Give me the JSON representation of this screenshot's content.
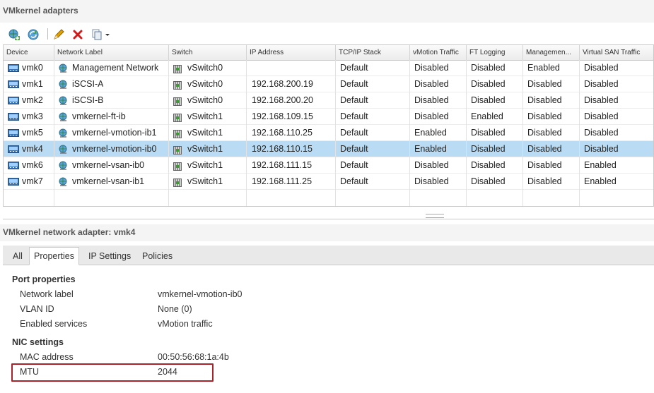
{
  "panel": {
    "title": "VMkernel adapters"
  },
  "toolbar": {
    "buttons": [
      {
        "name": "add-host-networking-button",
        "icon": "add-network-icon"
      },
      {
        "name": "refresh-button",
        "icon": "refresh-icon"
      },
      {
        "name": "edit-settings-button",
        "icon": "pencil-icon"
      },
      {
        "name": "remove-button",
        "icon": "red-x-icon"
      },
      {
        "name": "more-actions-button",
        "icon": "copy-dropdown-icon"
      }
    ]
  },
  "grid": {
    "columns": [
      "Device",
      "Network Label",
      "Switch",
      "IP Address",
      "TCP/IP Stack",
      "vMotion Traffic",
      "FT Logging",
      "Managemen...",
      "Virtual SAN Traffic"
    ],
    "rows": [
      {
        "device": "vmk0",
        "label": "Management Network",
        "switch": "vSwitch0",
        "ip": "",
        "stack": "Default",
        "vmotion": "Disabled",
        "ft": "Disabled",
        "mgmt": "Enabled",
        "vsan": "Disabled"
      },
      {
        "device": "vmk1",
        "label": "iSCSI-A",
        "switch": "vSwitch0",
        "ip": "192.168.200.19",
        "stack": "Default",
        "vmotion": "Disabled",
        "ft": "Disabled",
        "mgmt": "Disabled",
        "vsan": "Disabled"
      },
      {
        "device": "vmk2",
        "label": "iSCSI-B",
        "switch": "vSwitch0",
        "ip": "192.168.200.20",
        "stack": "Default",
        "vmotion": "Disabled",
        "ft": "Disabled",
        "mgmt": "Disabled",
        "vsan": "Disabled"
      },
      {
        "device": "vmk3",
        "label": "vmkernel-ft-ib",
        "switch": "vSwitch1",
        "ip": "192.168.109.15",
        "stack": "Default",
        "vmotion": "Disabled",
        "ft": "Enabled",
        "mgmt": "Disabled",
        "vsan": "Disabled"
      },
      {
        "device": "vmk5",
        "label": "vmkernel-vmotion-ib1",
        "switch": "vSwitch1",
        "ip": "192.168.110.25",
        "stack": "Default",
        "vmotion": "Enabled",
        "ft": "Disabled",
        "mgmt": "Disabled",
        "vsan": "Disabled"
      },
      {
        "device": "vmk4",
        "label": "vmkernel-vmotion-ib0",
        "switch": "vSwitch1",
        "ip": "192.168.110.15",
        "stack": "Default",
        "vmotion": "Enabled",
        "ft": "Disabled",
        "mgmt": "Disabled",
        "vsan": "Disabled",
        "selected": true
      },
      {
        "device": "vmk6",
        "label": "vmkernel-vsan-ib0",
        "switch": "vSwitch1",
        "ip": "192.168.111.15",
        "stack": "Default",
        "vmotion": "Disabled",
        "ft": "Disabled",
        "mgmt": "Disabled",
        "vsan": "Enabled"
      },
      {
        "device": "vmk7",
        "label": "vmkernel-vsan-ib1",
        "switch": "vSwitch1",
        "ip": "192.168.111.25",
        "stack": "Default",
        "vmotion": "Disabled",
        "ft": "Disabled",
        "mgmt": "Disabled",
        "vsan": "Enabled"
      }
    ]
  },
  "detail": {
    "title": "VMkernel network adapter: vmk4",
    "tabs": [
      "All",
      "Properties",
      "IP Settings",
      "Policies"
    ],
    "active_tab": "Properties",
    "port_properties": {
      "heading": "Port properties",
      "items": [
        {
          "label": "Network label",
          "value": "vmkernel-vmotion-ib0"
        },
        {
          "label": "VLAN ID",
          "value": "None (0)"
        },
        {
          "label": "Enabled services",
          "value": "vMotion traffic"
        }
      ]
    },
    "nic_settings": {
      "heading": "NIC settings",
      "items": [
        {
          "label": "MAC address",
          "value": "00:50:56:68:1a:4b"
        },
        {
          "label": "MTU",
          "value": "2044"
        }
      ]
    }
  },
  "colors": {
    "selected_row": "#b9dcf4",
    "highlight_box": "#a5232a"
  }
}
